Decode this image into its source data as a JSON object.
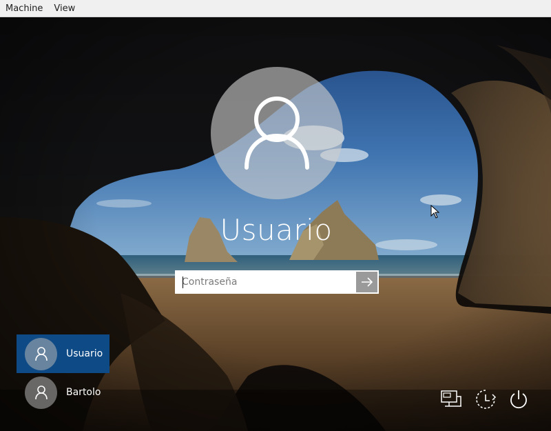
{
  "menubar": {
    "items": [
      "Machine",
      "View"
    ]
  },
  "lockscreen": {
    "username": "Usuario",
    "password_placeholder": "Contraseña",
    "users": [
      {
        "name": "Usuario",
        "selected": true
      },
      {
        "name": "Bartolo",
        "selected": false
      }
    ],
    "icons": {
      "network": "network-icon",
      "ease_of_access": "ease-of-access-icon",
      "power": "power-icon",
      "submit": "arrow-right-icon"
    },
    "colors": {
      "selected_user_bg": "#0e4a86"
    }
  }
}
